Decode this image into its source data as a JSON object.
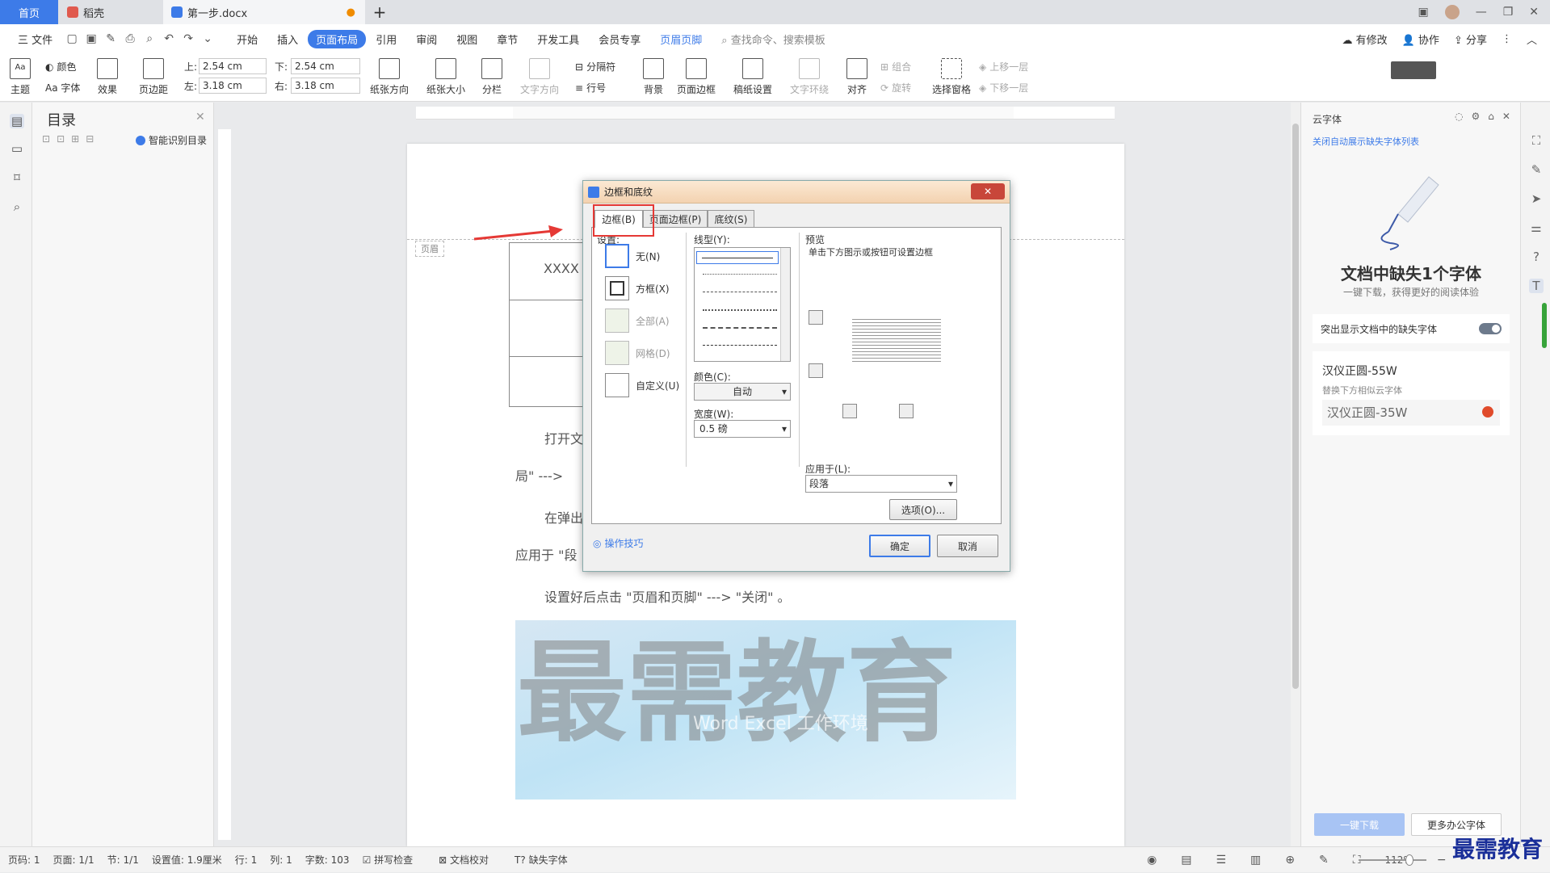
{
  "tabs": {
    "home": "首页",
    "daoke": "稻壳",
    "doc": "第一步.docx",
    "add": "+"
  },
  "menu": {
    "file": "三 文件",
    "items": [
      "开始",
      "插入",
      "页面布局",
      "引用",
      "审阅",
      "视图",
      "章节",
      "开发工具",
      "会员专享",
      "页眉页脚"
    ],
    "active": "页面布局",
    "search": "查找命令、搜索模板",
    "right": [
      "有修改",
      "协作",
      "分享"
    ]
  },
  "ribbon": {
    "theme": "主题",
    "colors": "颜色",
    "fonts": "Aa 字体",
    "effects": "效果",
    "margins": "页边距",
    "top_label": "上:",
    "top_value": "2.54 cm",
    "bottom_label": "下:",
    "bottom_value": "2.54 cm",
    "left_label": "左:",
    "left_value": "3.18 cm",
    "right_label": "右:",
    "right_value": "3.18 cm",
    "orientation": "纸张方向",
    "size": "纸张大小",
    "columns": "分栏",
    "text_direction": "文字方向",
    "breaks": "分隔符",
    "line_numbers": "行号",
    "background": "背景",
    "page_border": "页面边框",
    "grid_paper": "稿纸设置",
    "wrap": "文字环绕",
    "align": "对齐",
    "group": "组合",
    "rotate": "旋转",
    "select_pane": "选择窗格",
    "bring_forward": "上移一层",
    "send_backward": "下移一层"
  },
  "toc": {
    "title": "目录",
    "smart": "智能识别目录"
  },
  "document": {
    "header_tag": "页眉",
    "cell_text": "XXXX",
    "para1": "打开文",
    "para1_tail": "局\" --->",
    "para2": "在弹出",
    "para2_tail": "应用于 \"段",
    "para3": "设置好后点击 \"页眉和页脚\" ---> \"关闭\" 。",
    "watermark": "最需教育",
    "watermark_sub": "Word Excel 工作环境"
  },
  "dialog": {
    "title": "边框和底纹",
    "tabs": [
      "边框(B)",
      "页面边框(P)",
      "底纹(S)"
    ],
    "settings_label": "设置:",
    "settings": [
      "无(N)",
      "方框(X)",
      "全部(A)",
      "网格(D)",
      "自定义(U)"
    ],
    "line_style_label": "线型(Y):",
    "color_label": "颜色(C):",
    "color_value": "自动",
    "width_label": "宽度(W):",
    "width_value": "0.5 磅",
    "preview_label": "预览",
    "preview_hint": "单击下方图示或按钮可设置边框",
    "apply_label": "应用于(L):",
    "apply_value": "段落",
    "options_btn": "选项(O)...",
    "tips": "操作技巧",
    "ok": "确定",
    "cancel": "取消"
  },
  "rpanel": {
    "title": "云字体",
    "link": "关闭自动展示缺失字体列表",
    "heading": "文档中缺失1个字体",
    "sub": "一键下载，获得更好的阅读体验",
    "toggle_label": "突出显示文档中的缺失字体",
    "font_name": "汉仪正圆-55W",
    "replace_hint": "替换下方相似云字体",
    "alt_font": "汉仪正圆-35W",
    "download_btn": "一键下载",
    "more_btn": "更多办公字体"
  },
  "status": {
    "page_code": "页码: 1",
    "page": "页面: 1/1",
    "section": "节: 1/1",
    "setting": "设置值: 1.9厘米",
    "row": "行: 1",
    "col": "列: 1",
    "words": "字数: 103",
    "spell": "拼写检查",
    "proof": "文档校对",
    "missing_font": "缺失字体",
    "zoom": "112%"
  },
  "brand": "最需教育"
}
